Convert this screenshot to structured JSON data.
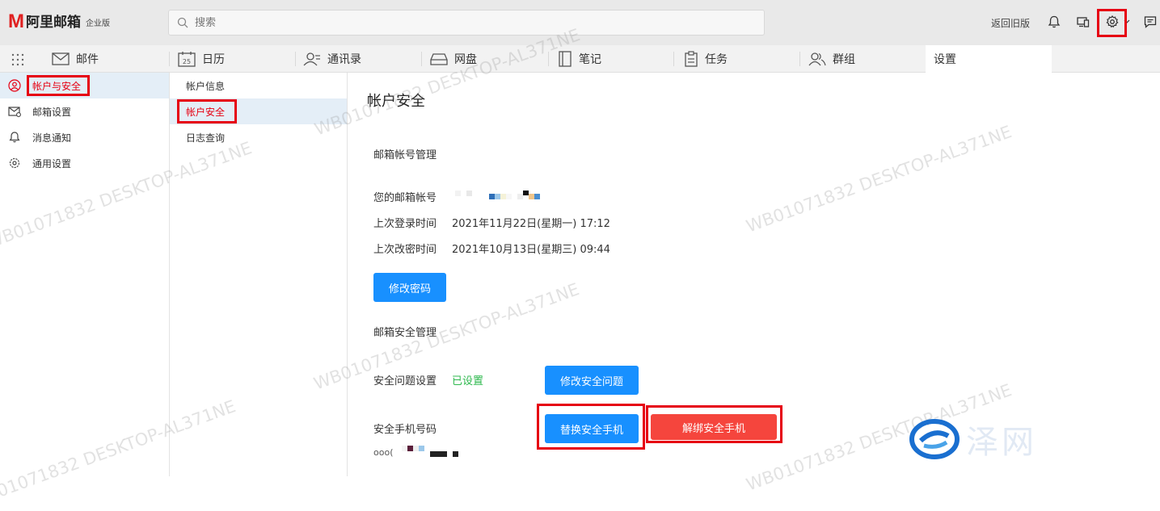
{
  "brand": {
    "logo_letter": "M",
    "name": "阿里邮箱",
    "edition": "企业版"
  },
  "search": {
    "placeholder": "搜索"
  },
  "header": {
    "old_version_label": "返回旧版"
  },
  "nav": {
    "tabs": [
      {
        "label": "邮件",
        "icon": "mail-icon"
      },
      {
        "label": "日历",
        "icon": "calendar-icon",
        "badge": "25"
      },
      {
        "label": "通讯录",
        "icon": "contacts-icon"
      },
      {
        "label": "网盘",
        "icon": "drive-icon"
      },
      {
        "label": "笔记",
        "icon": "notes-icon"
      },
      {
        "label": "任务",
        "icon": "tasks-icon"
      },
      {
        "label": "群组",
        "icon": "group-icon"
      },
      {
        "label": "设置",
        "icon": ""
      }
    ],
    "active": "设置"
  },
  "sidebar": {
    "items": [
      {
        "label": "帐户与安全",
        "icon": "user-circle-icon",
        "active": true
      },
      {
        "label": "邮箱设置",
        "icon": "mail-settings-icon",
        "active": false
      },
      {
        "label": "消息通知",
        "icon": "bell-icon",
        "active": false
      },
      {
        "label": "通用设置",
        "icon": "gear-icon",
        "active": false
      }
    ]
  },
  "subnav": {
    "items": [
      {
        "label": "帐户信息",
        "active": false
      },
      {
        "label": "帐户安全",
        "active": true
      },
      {
        "label": "日志查询",
        "active": false
      }
    ]
  },
  "main": {
    "title": "帐户安全",
    "account_section": {
      "title": "邮箱帐号管理",
      "account_label": "您的邮箱帐号",
      "last_login_label": "上次登录时间",
      "last_login_value": "2021年11月22日(星期一) 17:12",
      "last_pwd_change_label": "上次改密时间",
      "last_pwd_change_value": "2021年10月13日(星期三) 09:44",
      "change_password_button": "修改密码"
    },
    "security_section": {
      "title": "邮箱安全管理",
      "question_label": "安全问题设置",
      "question_status": "已设置",
      "change_question_button": "修改安全问题",
      "phone_label": "安全手机号码",
      "phone_value_prefix": "ooo(",
      "replace_phone_button": "替换安全手机",
      "unbind_phone_button": "解绑安全手机"
    }
  },
  "watermark": {
    "text": "WB01071832 DESKTOP-AL371NE",
    "brand_text": "泽网"
  },
  "colors": {
    "accent": "#1890ff",
    "danger": "#f5453d",
    "highlight": "#e60012",
    "success": "#2db84d"
  }
}
